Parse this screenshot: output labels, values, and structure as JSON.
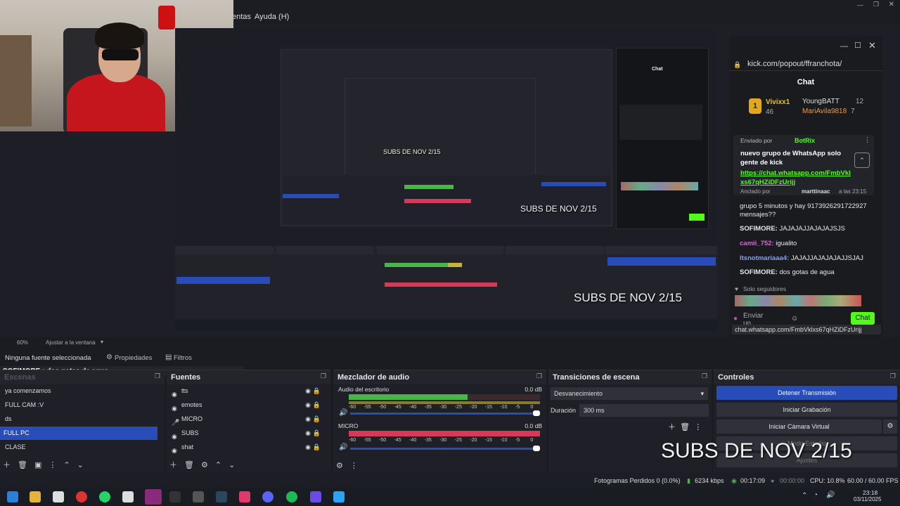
{
  "menu": {
    "items": [
      "entas",
      "Ayuda (H)"
    ]
  },
  "webcam": {
    "label": "Webcam stream"
  },
  "inner_obs": {
    "overlay": "SUBS  DE NOV 2/15",
    "scenes_title": "Escenas",
    "sources_title": "Fuentes",
    "mixer_title": "Mezclador de audio",
    "transitions_title": "Transiciones de escena",
    "controls_title": "Controles",
    "inner_subs_1": "SUBS  DE NOV 2/15",
    "inner_subs_2": "SUBS  DE NOV 2/15"
  },
  "chat_window": {
    "url": "kick.com/popout/ffranchota/",
    "title": "Chat",
    "top_users": [
      {
        "rank": "1",
        "name": "Vivixx1",
        "count": "46"
      },
      {
        "name": "YoungBATT",
        "count": "12"
      },
      {
        "name": "MariAvila9818",
        "count": "7"
      }
    ],
    "pinned": {
      "sent_by": "Enviado por",
      "bot": "BotRix",
      "message": "nuevo grupo de WhatsApp solo gente de kick",
      "link": "https://chat.whatsapp.com/FmbVklxs67qHZiDFzUrijj",
      "pinned_by": "Anclado por",
      "pinner": "marttinaac",
      "time": "a las 23:15"
    },
    "messages": [
      {
        "text": "grupo 5 minutos y hay 9173926291722927"
      },
      {
        "text": "mensajes??"
      },
      {
        "user": "SOFIMORE:",
        "text": " JAJAJAJJAJAJAJSJS",
        "color": "#e8e8e8"
      },
      {
        "user": "camii_752:",
        "text": " igualito",
        "color": "#d36bd6"
      },
      {
        "user": "ltsnotmariaaa4:",
        "text": " JAJAJJAJAJAJAJJSJAJ",
        "color": "#7ea0ff"
      },
      {
        "user": "SOFIMORE:",
        "text": " dos gotas de agua",
        "color": "#e8e8e8"
      }
    ],
    "followers_only": "Solo seguidores",
    "send_placeholder": "Enviar un",
    "chat_button": "Chat",
    "status_url": "chat.whatsapp.com/FmbVklxs67qHZiDFzUrijj"
  },
  "zoom": {
    "value": "60%",
    "fit_label": "Ajustar a la ventana"
  },
  "propbar": {
    "no_source": "Ninguna fuente seleccionada",
    "properties": "Propiedades",
    "filters": "Filtros",
    "chat_overlay": "SOFIMORE : dos gotas de agua"
  },
  "scenes": {
    "title": "Escenas",
    "items": [
      "ya comenzamos",
      "FULL CAM :V",
      "ds",
      "FULL PC",
      "CLASE"
    ],
    "selected_index": 3
  },
  "sources": {
    "title": "Fuentes",
    "items": [
      "tts",
      "emotes",
      "MICRO",
      "SUBS",
      "shat"
    ]
  },
  "mixer": {
    "title": "Mezclador de audio",
    "channels": [
      {
        "name": "Audio del escritorio",
        "db": "0.0 dB",
        "level": 0.62
      },
      {
        "name": "MICRO",
        "db": "0.0 dB",
        "level": 0.66
      }
    ],
    "ticks": [
      "-60",
      "-55",
      "-50",
      "-45",
      "-40",
      "-35",
      "-30",
      "-25",
      "-20",
      "-15",
      "-10",
      "-5",
      "0"
    ]
  },
  "transitions": {
    "title": "Transiciones de escena",
    "selected": "Desvanecimiento",
    "duration_label": "Duración",
    "duration_value": "300 ms"
  },
  "controls": {
    "title": "Controles",
    "buttons": [
      "Detener Transmisión",
      "Iniciar Grabación",
      "Iniciar Cámara Virtual",
      "Modo Estudio",
      "Ajustes"
    ]
  },
  "overlay_subs": "SUBS  DE NOV 2/15",
  "status": {
    "frames_lost": "Fotogramas Perdidos 0 (0.0%)",
    "bitrate": "6234 kbps",
    "stream_time": "00:17:09",
    "rec_time": "00:00:00",
    "cpu": "CPU: 10.8%",
    "fps": "60.00 / 60.00 FPS"
  },
  "taskbar": {
    "time": "23:18",
    "date": "03/11/2025",
    "colors": {
      "accent": "#284cb8",
      "obs": "#8a2a7a",
      "spotify": "#1db954",
      "whatsapp": "#25d366",
      "kick_green": "#53fc18"
    }
  }
}
